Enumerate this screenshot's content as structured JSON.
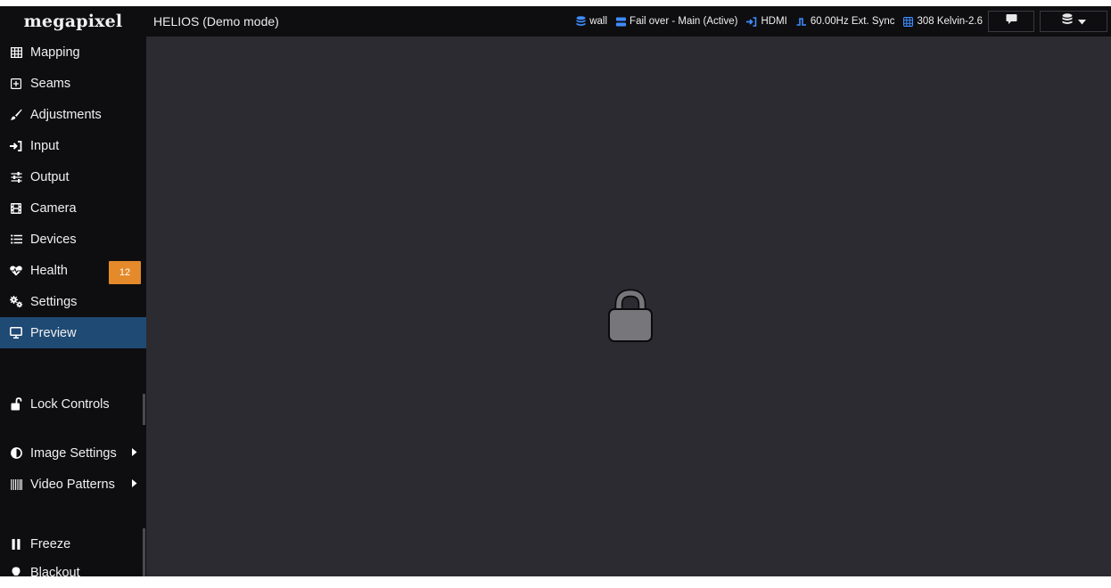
{
  "header": {
    "brand": "megapixel",
    "title": "HELIOS (Demo mode)",
    "status": {
      "wall": "wall",
      "failover": "Fail over - Main (Active)",
      "input": "HDMI",
      "sync": "60.00Hz Ext. Sync",
      "panel": "308 Kelvin-2.6"
    }
  },
  "sidebar": {
    "items": [
      {
        "label": "Mapping",
        "icon": "grid-icon"
      },
      {
        "label": "Seams",
        "icon": "plus-square-icon"
      },
      {
        "label": "Adjustments",
        "icon": "brush-icon"
      },
      {
        "label": "Input",
        "icon": "sign-in-icon"
      },
      {
        "label": "Output",
        "icon": "sliders-icon"
      },
      {
        "label": "Camera",
        "icon": "film-icon"
      },
      {
        "label": "Devices",
        "icon": "list-icon"
      },
      {
        "label": "Health",
        "icon": "heartbeat-icon",
        "badge": "12"
      },
      {
        "label": "Settings",
        "icon": "cogs-icon"
      },
      {
        "label": "Preview",
        "icon": "monitor-icon",
        "active": true
      }
    ],
    "lock_controls": "Lock Controls",
    "image_settings": "Image Settings",
    "video_patterns": "Video Patterns",
    "freeze": "Freeze",
    "blackout": "Blackout"
  },
  "colors": {
    "topbar_bg": "#0e0e10",
    "main_bg": "#2c2b31",
    "active_bg": "#1f4a74",
    "badge_bg": "#e48a2a",
    "status_icon_blue": "#3f8cff",
    "lock_fill": "#77777b"
  },
  "main": {
    "center_icon": "lock-icon"
  }
}
